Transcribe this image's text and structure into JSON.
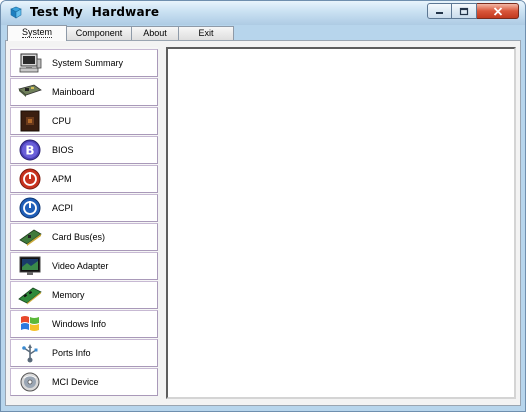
{
  "window": {
    "title": "Test My  Hardware",
    "controls": {
      "minimize": "minimize",
      "maximize": "maximize",
      "close": "close"
    }
  },
  "tabs": [
    {
      "label": "System",
      "active": true
    },
    {
      "label": "Component",
      "active": false
    },
    {
      "label": "About",
      "active": false
    },
    {
      "label": "Exit",
      "active": false
    }
  ],
  "sidebar": {
    "items": [
      {
        "label": "System Summary",
        "icon": "computer-icon"
      },
      {
        "label": "Mainboard",
        "icon": "mainboard-icon"
      },
      {
        "label": "CPU",
        "icon": "cpu-icon"
      },
      {
        "label": "BIOS",
        "icon": "bios-icon"
      },
      {
        "label": "APM",
        "icon": "apm-icon"
      },
      {
        "label": "ACPI",
        "icon": "acpi-icon"
      },
      {
        "label": "Card Bus(es)",
        "icon": "card-bus-icon"
      },
      {
        "label": "Video Adapter",
        "icon": "video-adapter-icon"
      },
      {
        "label": "Memory",
        "icon": "memory-icon"
      },
      {
        "label": "Windows Info",
        "icon": "windows-icon"
      },
      {
        "label": "Ports Info",
        "icon": "ports-icon"
      },
      {
        "label": "MCI Device",
        "icon": "mci-device-icon"
      }
    ]
  },
  "colors": {
    "titlebar": "#c9e1f2",
    "close_button": "#d9573b",
    "bios_blue": "#4a3fb8",
    "apm_red": "#c8321e",
    "acpi_blue": "#1f5fb8"
  }
}
